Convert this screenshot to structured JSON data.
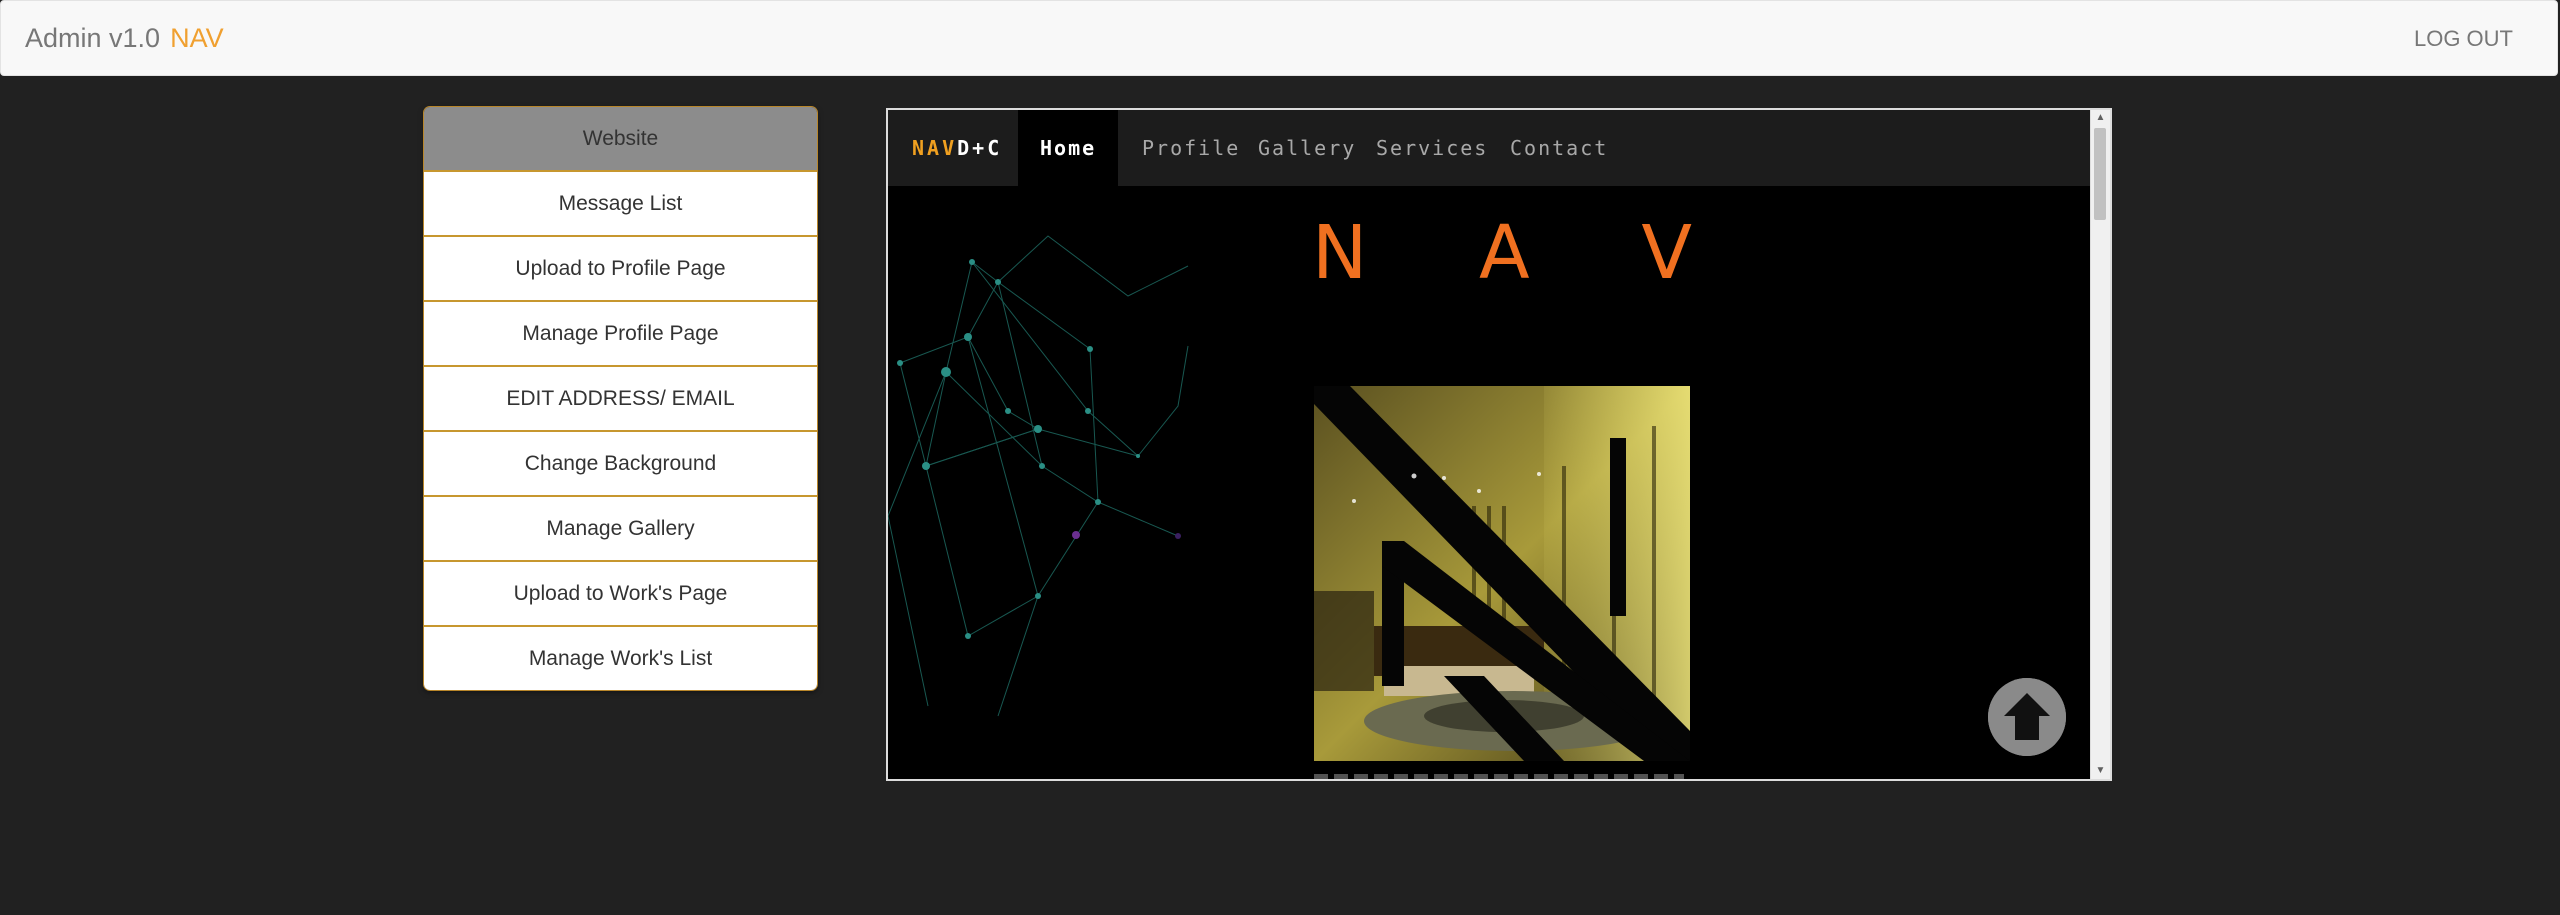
{
  "topbar": {
    "brand_prefix": "Admin v1.0",
    "brand_accent": "NAV",
    "logout_label": "LOG OUT"
  },
  "menu": {
    "items": [
      {
        "label": "Website",
        "active": true
      },
      {
        "label": "Message List"
      },
      {
        "label": "Upload to Profile Page"
      },
      {
        "label": "Manage Profile Page"
      },
      {
        "label": "EDIT ADDRESS/ EMAIL"
      },
      {
        "label": "Change Background"
      },
      {
        "label": "Manage Gallery"
      },
      {
        "label": "Upload to Work's Page"
      },
      {
        "label": "Manage Work's List"
      }
    ]
  },
  "preview": {
    "logo_accent": "NAV",
    "logo_rest": "D+C",
    "nav": [
      "Home",
      "Profile",
      "Gallery",
      "Services",
      "Contact"
    ],
    "hero_letters": [
      "N",
      "A",
      "V"
    ],
    "icons": {
      "scroll_up": "arrow-up-icon",
      "to_top": "circle-arrow-up-icon"
    }
  },
  "colors": {
    "accent": "#f0a030",
    "hero": "#f07020",
    "background": "#212121"
  }
}
